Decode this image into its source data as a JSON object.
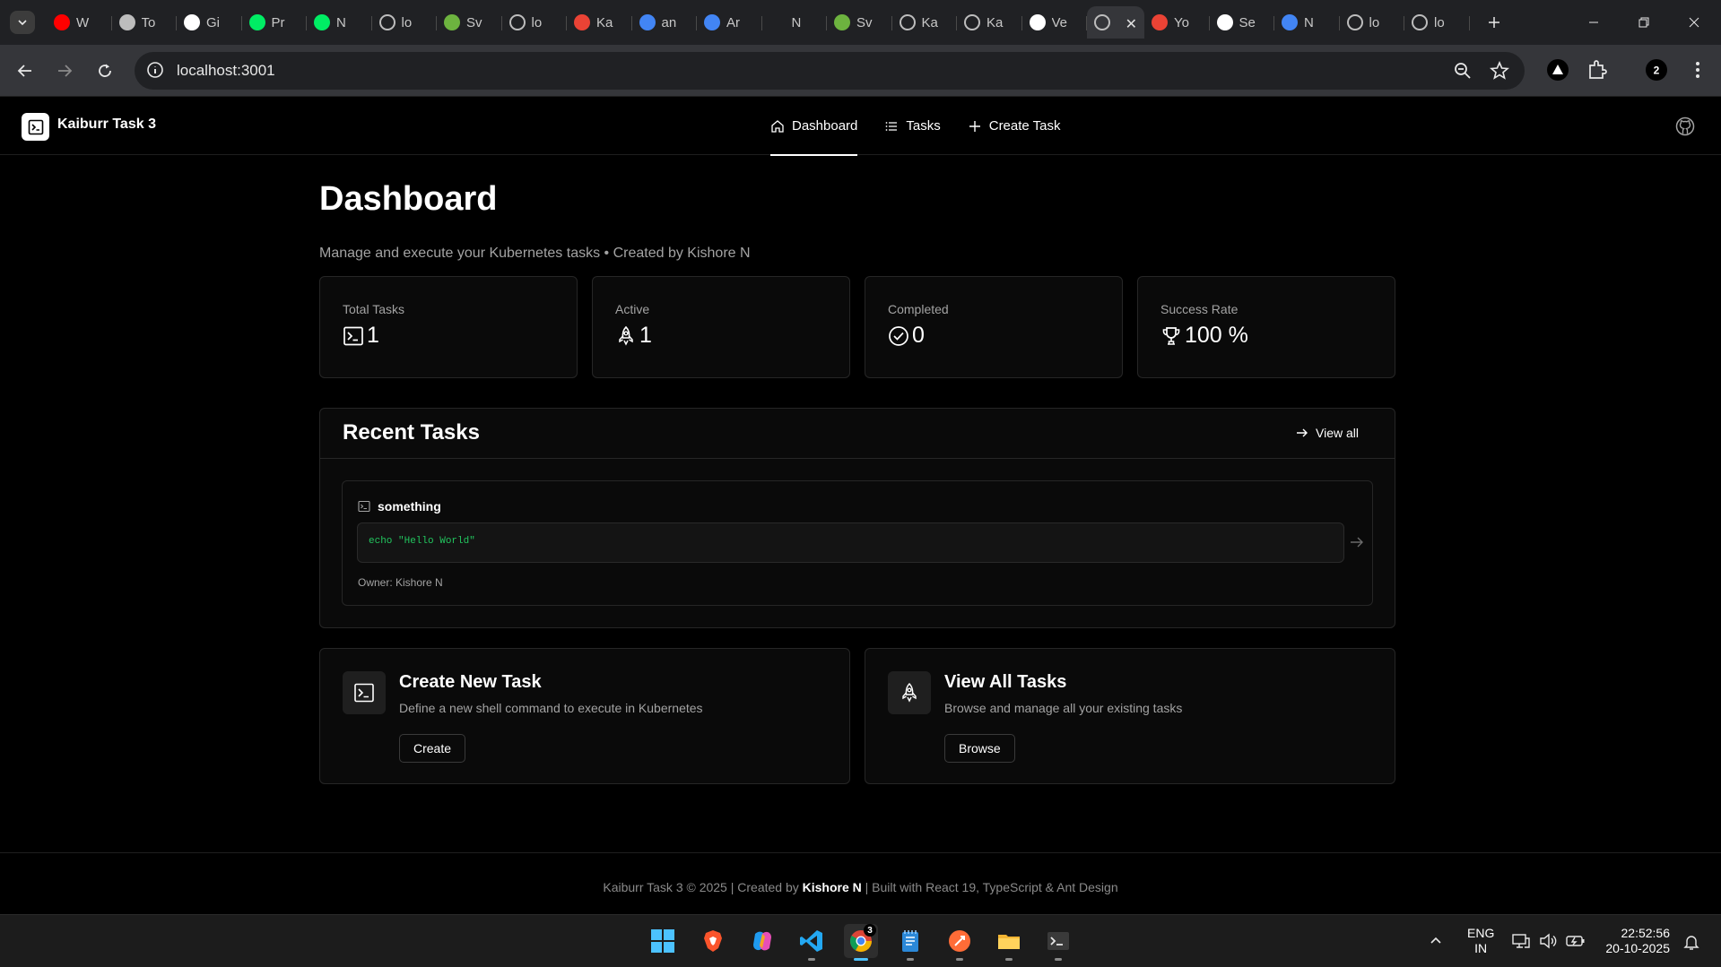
{
  "browser": {
    "tabs": [
      {
        "title": "W",
        "favicon": "youtube-icon",
        "color": "#ff0000"
      },
      {
        "title": "To",
        "favicon": "feather-icon",
        "color": "#bdbdbd"
      },
      {
        "title": "Gi",
        "favicon": "github-icon",
        "color": "#ffffff"
      },
      {
        "title": "Pr",
        "favicon": "mongodb-leaf-icon",
        "color": "#00ed64"
      },
      {
        "title": "N",
        "favicon": "mongodb-leaf-icon",
        "color": "#00ed64"
      },
      {
        "title": "lo",
        "favicon": "globe-icon",
        "color": "#bdbdbd"
      },
      {
        "title": "Sv",
        "favicon": "spring-icon",
        "color": "#6db33f"
      },
      {
        "title": "lo",
        "favicon": "globe-icon",
        "color": "#bdbdbd"
      },
      {
        "title": "Ka",
        "favicon": "gmail-icon",
        "color": "#ea4335"
      },
      {
        "title": "an",
        "favicon": "google-icon",
        "color": "#4285f4"
      },
      {
        "title": "Ar",
        "favicon": "diamond-icon",
        "color": "#4285f4"
      },
      {
        "title": "N",
        "favicon": "blank-icon",
        "color": "#202124"
      },
      {
        "title": "Sv",
        "favicon": "spring-icon",
        "color": "#6db33f"
      },
      {
        "title": "Ka",
        "favicon": "globe-icon",
        "color": "#bdbdbd"
      },
      {
        "title": "Ka",
        "favicon": "globe-icon",
        "color": "#bdbdbd"
      },
      {
        "title": "Ve",
        "favicon": "vercel-icon",
        "color": "#ffffff"
      },
      {
        "title": "",
        "favicon": "globe-icon",
        "color": "#bdbdbd",
        "active": true
      },
      {
        "title": "Yo",
        "favicon": "gmail-icon",
        "color": "#ea4335"
      },
      {
        "title": "Se",
        "favicon": "github-icon",
        "color": "#ffffff"
      },
      {
        "title": "N",
        "favicon": "google-icon",
        "color": "#4285f4"
      },
      {
        "title": "lo",
        "favicon": "globe-icon",
        "color": "#bdbdbd"
      },
      {
        "title": "lo",
        "favicon": "globe-icon",
        "color": "#bdbdbd"
      }
    ],
    "url": "localhost:3001",
    "profile_initial": "2"
  },
  "app": {
    "brand": "Kaiburr Task 3",
    "nav": {
      "dashboard": "Dashboard",
      "tasks": "Tasks",
      "create_task": "Create Task"
    },
    "page": {
      "title": "Dashboard",
      "subtitle": "Manage and execute your Kubernetes tasks • Created by Kishore N"
    },
    "stats": {
      "total": {
        "label": "Total Tasks",
        "value": "1"
      },
      "active": {
        "label": "Active",
        "value": "1"
      },
      "completed": {
        "label": "Completed",
        "value": "0"
      },
      "success": {
        "label": "Success Rate",
        "value": "100 %"
      }
    },
    "recent": {
      "title": "Recent Tasks",
      "view_all": "View all",
      "task": {
        "name": "something",
        "command": "echo \"Hello World\"",
        "owner": "Owner: Kishore N"
      }
    },
    "actions": {
      "create": {
        "title": "Create New Task",
        "desc": "Define a new shell command to execute in Kubernetes",
        "button": "Create"
      },
      "browse": {
        "title": "View All Tasks",
        "desc": "Browse and manage all your existing tasks",
        "button": "Browse"
      }
    },
    "footer": {
      "prefix": "Kaiburr Task 3 © 2025 | Created by ",
      "author": "Kishore N",
      "suffix": " | Built with React 19, TypeScript & Ant Design"
    }
  },
  "taskbar": {
    "apps": [
      "windows-start-icon",
      "brave-icon",
      "copilot-icon",
      "vscode-icon",
      "chrome-icon",
      "notepad-icon",
      "postman-icon",
      "file-explorer-icon",
      "terminal-icon"
    ],
    "chrome_badge": "3",
    "lang_top": "ENG",
    "lang_bottom": "IN",
    "time": "22:52:56",
    "date": "20-10-2025"
  },
  "colors": {
    "command_text": "#22c55e",
    "accent_taskbar": "#4cc2ff"
  }
}
